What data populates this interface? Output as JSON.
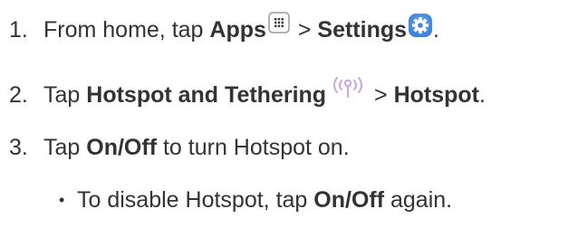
{
  "steps": [
    {
      "number": "1.",
      "parts": {
        "a": "From home, tap ",
        "b": "Apps",
        "c": " > ",
        "d": "Settings",
        "e": "."
      },
      "icons": [
        "apps-grid-icon",
        "settings-gear-icon"
      ]
    },
    {
      "number": "2.",
      "parts": {
        "a": "Tap ",
        "b": "Hotspot and Tethering",
        "c": " > ",
        "d": "Hotspot",
        "e": "."
      },
      "icons": [
        "hotspot-signal-icon"
      ]
    },
    {
      "number": "3.",
      "parts": {
        "a": "Tap ",
        "b": "On/Off",
        "c": " to turn Hotspot on."
      }
    }
  ],
  "substep": {
    "bullet": "•",
    "parts": {
      "a": "To disable Hotspot, tap ",
      "b": "On/Off",
      "c": " again."
    }
  },
  "colors": {
    "text": "#333333",
    "apps_icon_border": "#9a9a9a",
    "settings_icon": "#4a8ee6",
    "hotspot_icon": "#c9a6e6"
  }
}
